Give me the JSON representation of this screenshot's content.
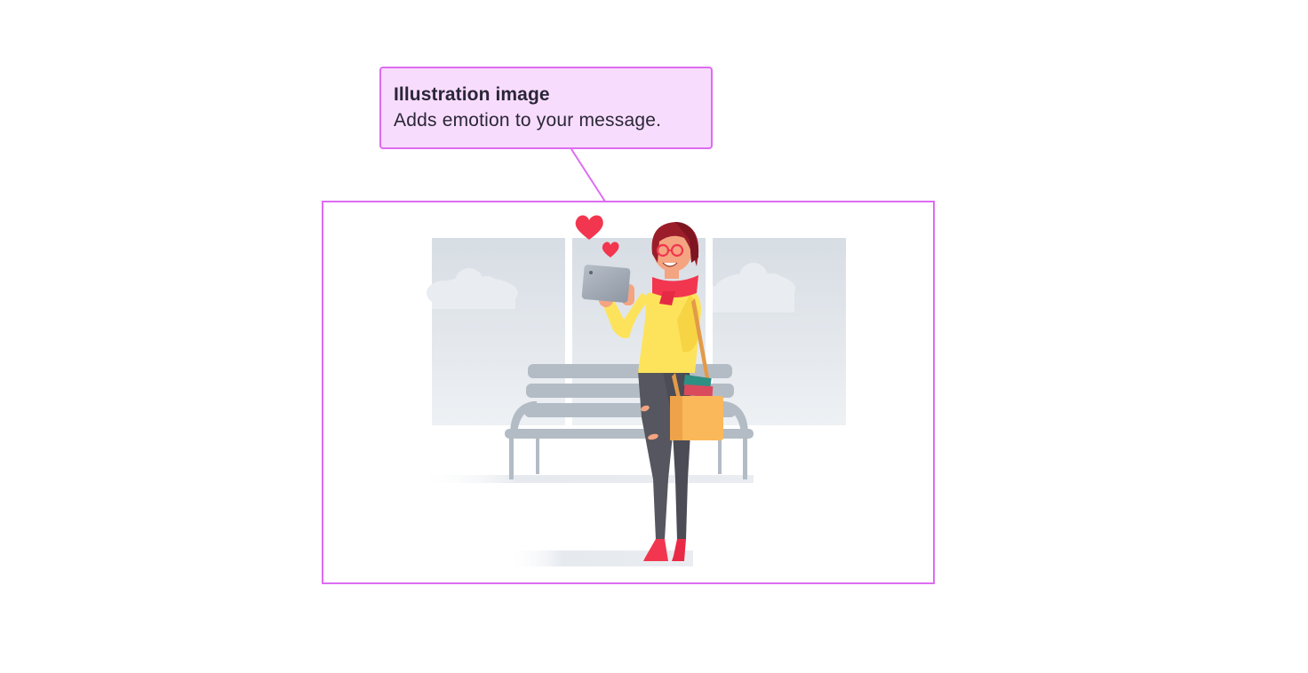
{
  "annotation": {
    "title": "Illustration image",
    "description": "Adds emotion to your message."
  },
  "colors": {
    "annotation_border": "#dd6cf2",
    "annotation_fill": "#f8dcfd",
    "text": "#2a2638"
  },
  "illustration": {
    "subject": "woman-with-tablet-at-bench",
    "icons": [
      "heart-icon",
      "tablet-icon",
      "bench-icon",
      "window-icon",
      "cloud-icon",
      "bag-icon"
    ]
  }
}
